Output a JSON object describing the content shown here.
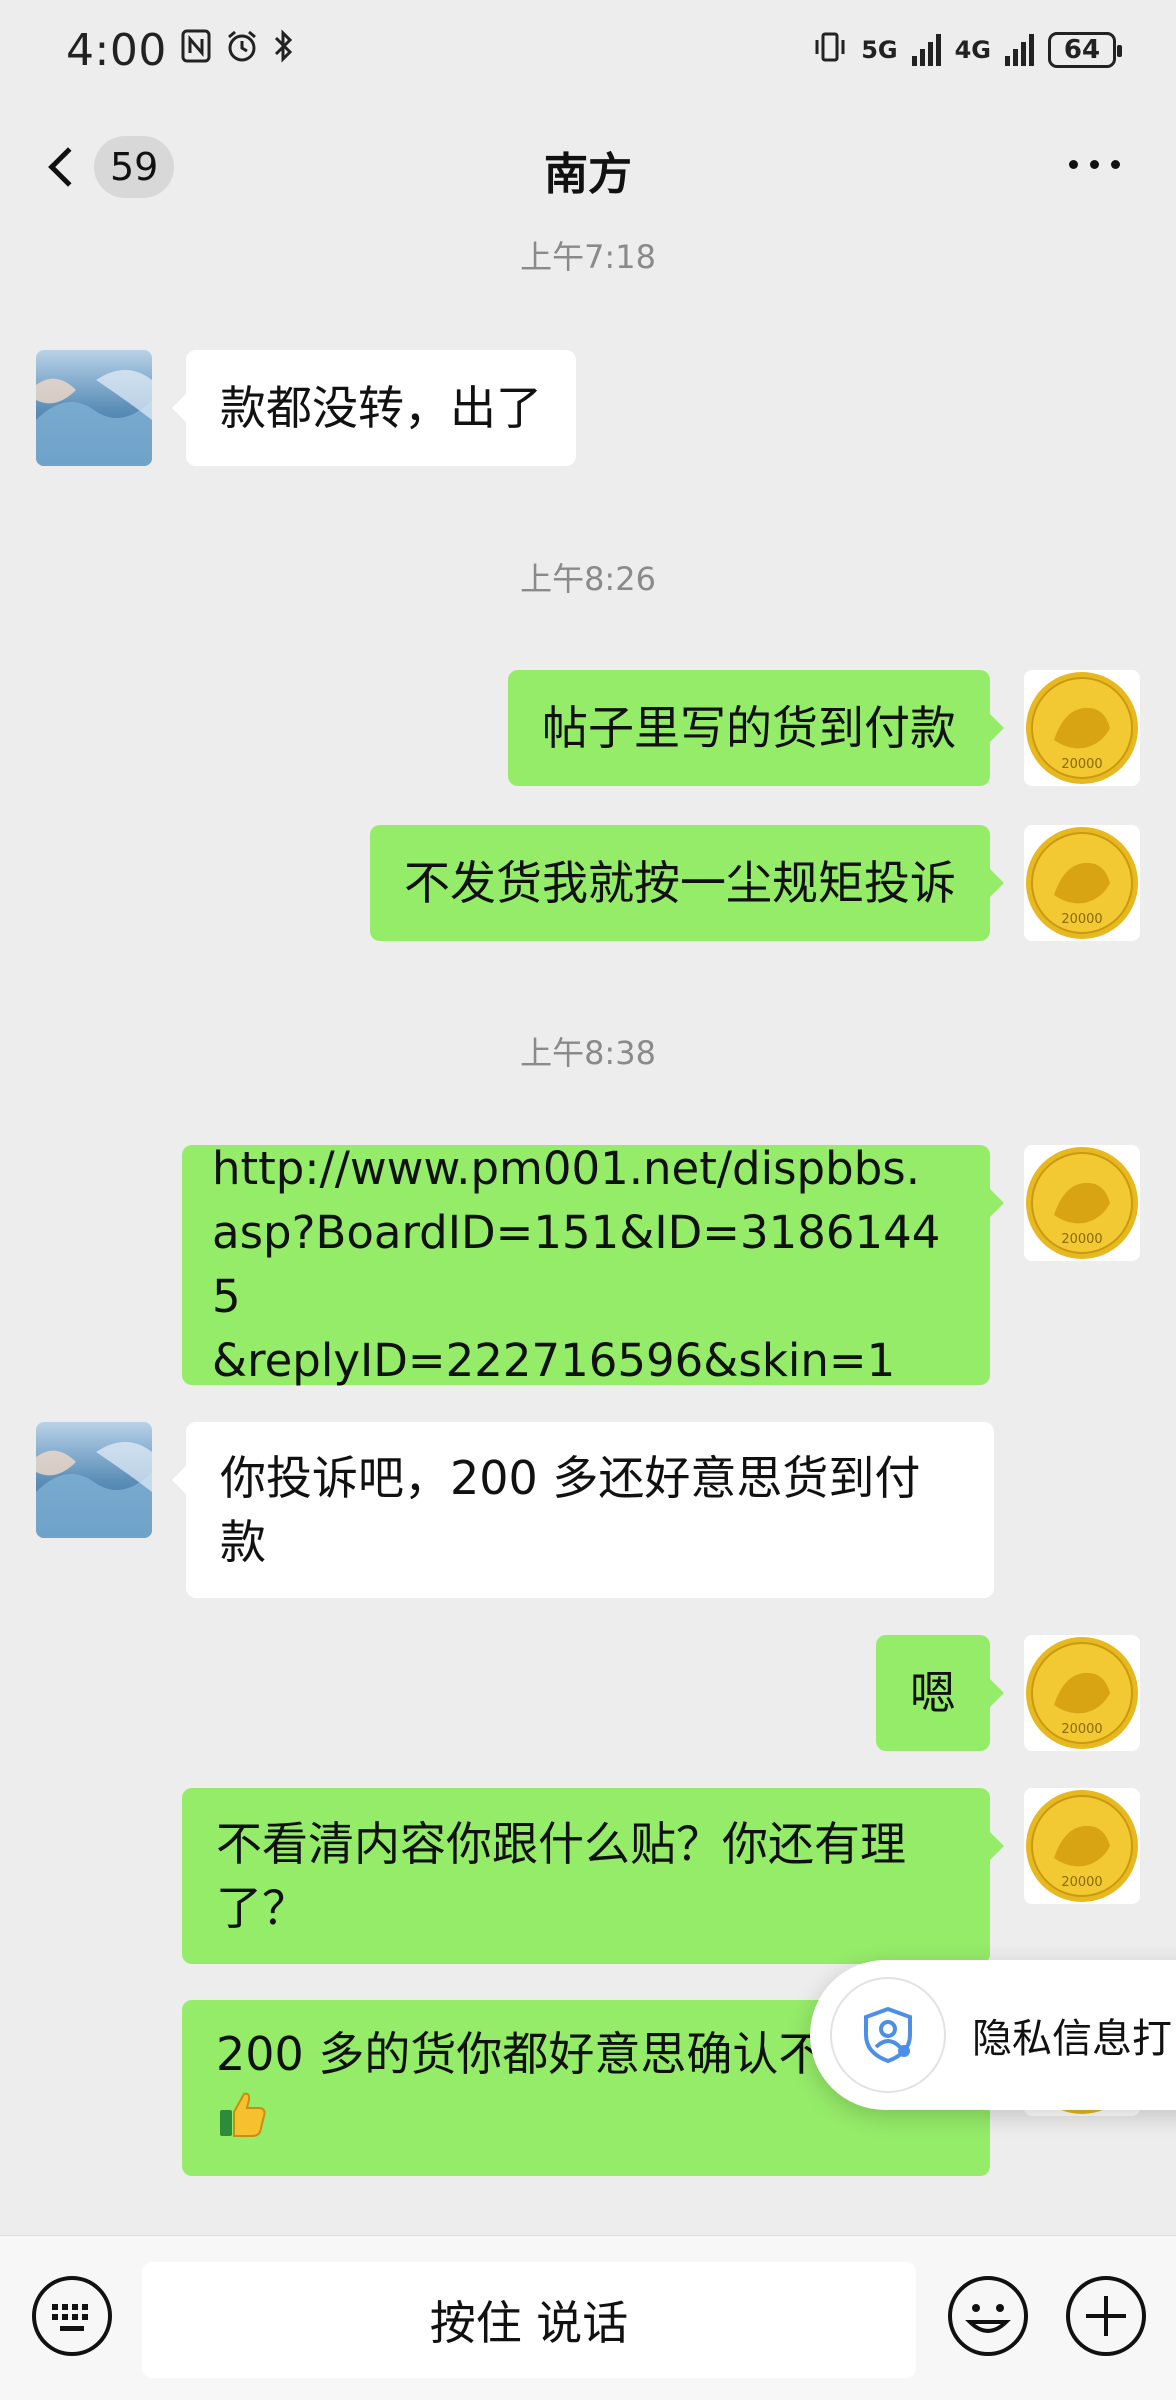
{
  "status_bar": {
    "time": "4:00",
    "network_5g": "5G",
    "network_4g": "4G",
    "battery": "64"
  },
  "header": {
    "unread_count": "59",
    "title": "南方"
  },
  "timestamps": [
    "上午7:18",
    "上午8:26",
    "上午8:38"
  ],
  "messages": [
    {
      "side": "in",
      "text": "款都没转，出了"
    },
    {
      "side": "out",
      "text": "帖子里写的货到付款"
    },
    {
      "side": "out",
      "text": "不发货我就按一尘规矩投诉"
    },
    {
      "side": "out",
      "text": "http://www.pm001.net/dispbbs.\nasp?BoardID=151&ID=31861445\n&replyID=222716596&skin=1"
    },
    {
      "side": "in",
      "text": "你投诉吧，200 多还好意思货到付\n款"
    },
    {
      "side": "out",
      "text": "嗯"
    },
    {
      "side": "out",
      "text": "不看清内容你跟什么贴？你还有理\n了？"
    },
    {
      "side": "out",
      "text": "200 多的货你都好意思确认不"
    }
  ],
  "privacy_popup": {
    "text": "隐私信息打"
  },
  "input_bar": {
    "voice_label": "按住 说话"
  },
  "colors": {
    "incoming_bubble": "#ffffff",
    "outgoing_bubble": "#95ec69",
    "background": "#ededed",
    "link": "#576b95"
  }
}
